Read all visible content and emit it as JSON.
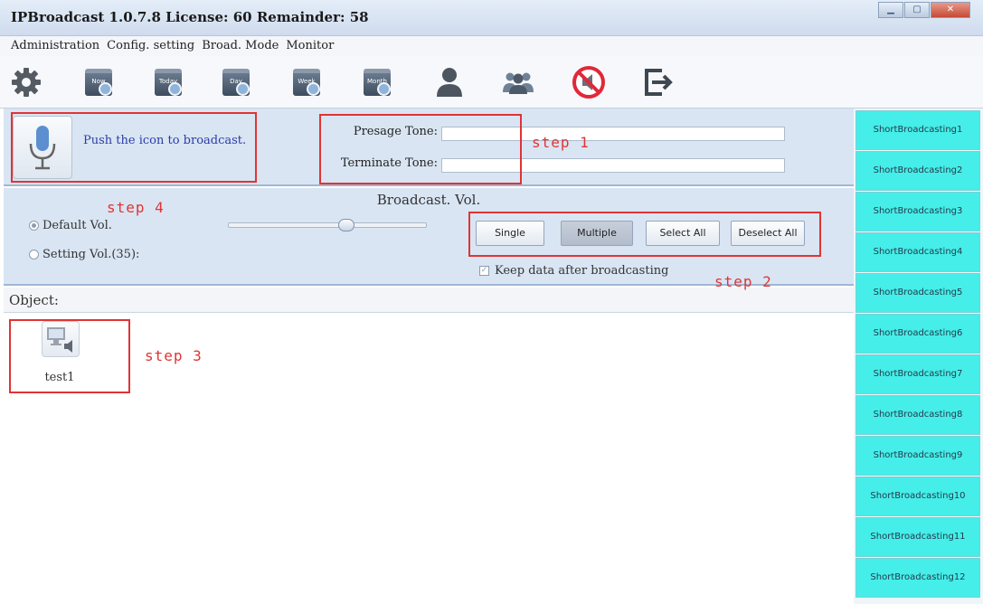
{
  "window": {
    "title": "IPBroadcast 1.0.7.8 License: 60 Remainder: 58"
  },
  "menu": [
    "Administration",
    "Config. setting",
    "Broad. Mode",
    "Monitor"
  ],
  "toolbar": {
    "icons": [
      "gear-icon",
      "calendar-now-icon",
      "calendar-today-icon",
      "calendar-day-icon",
      "calendar-week-icon",
      "calendar-month-icon",
      "user-icon",
      "users-group-icon",
      "stop-broadcast-icon",
      "exit-icon"
    ],
    "calendar_labels": [
      "Now",
      "Today",
      "Day",
      "Week",
      "Month"
    ]
  },
  "broadcast": {
    "push_text": "Push the icon to broadcast.",
    "presage_label": "Presage Tone:",
    "terminate_label": "Terminate Tone:",
    "presage_value": "",
    "terminate_value": ""
  },
  "volume": {
    "title": "Broadcast. Vol.",
    "default_label": "Default Vol.",
    "setting_label": "Setting Vol.(35):",
    "selected": "default",
    "slider_level": 35
  },
  "modes": {
    "single": "Single",
    "multiple": "Multiple",
    "select_all": "Select All",
    "deselect_all": "Deselect All",
    "pressed": "multiple"
  },
  "keep_data": {
    "label": "Keep data after broadcasting",
    "checked": true
  },
  "objects": {
    "heading": "Object:",
    "items": [
      {
        "name": "test1"
      }
    ]
  },
  "steps": [
    "step 1",
    "step 2",
    "step 3",
    "step 4"
  ],
  "short_broadcasts": [
    "ShortBroadcasting1",
    "ShortBroadcasting2",
    "ShortBroadcasting3",
    "ShortBroadcasting4",
    "ShortBroadcasting5",
    "ShortBroadcasting6",
    "ShortBroadcasting7",
    "ShortBroadcasting8",
    "ShortBroadcasting9",
    "ShortBroadcasting10",
    "ShortBroadcasting11",
    "ShortBroadcasting12"
  ],
  "colors": {
    "short_button": "#45eee8",
    "annotation": "#e03434",
    "panel": "#d9e5f3"
  }
}
